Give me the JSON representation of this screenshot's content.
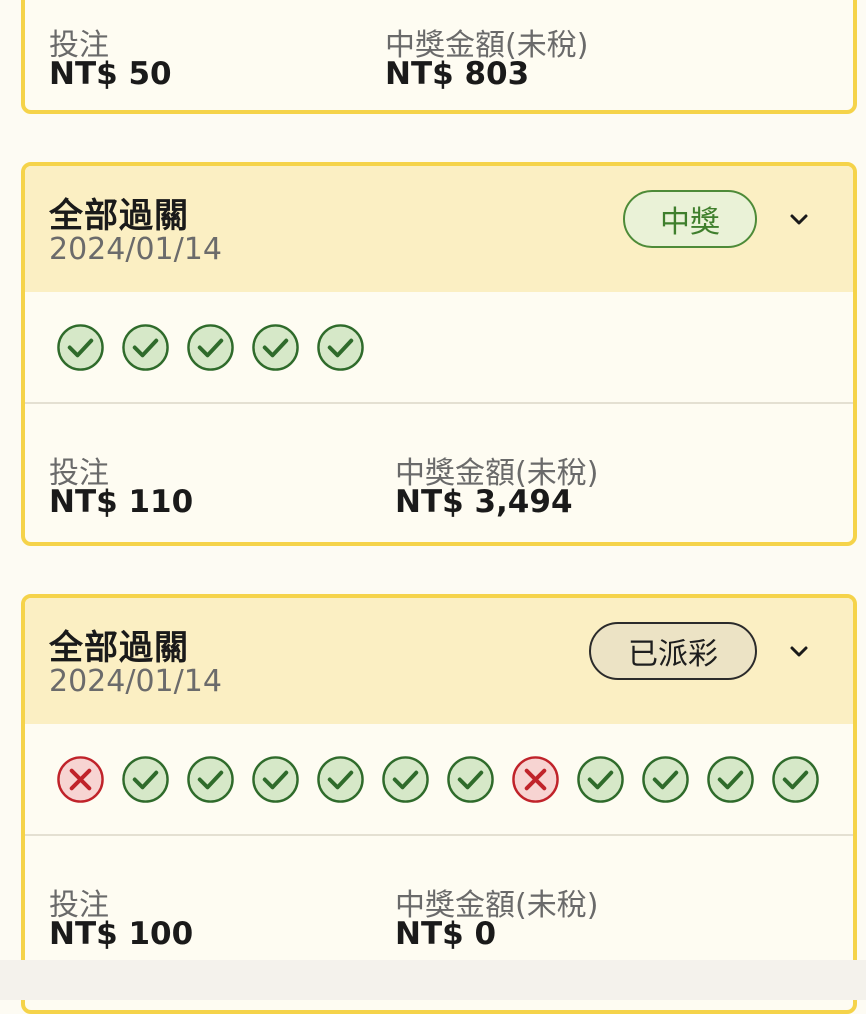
{
  "cards": [
    {
      "stake_label": "投注",
      "stake_value": "NT$ 50",
      "payout_label": "中獎金額(未稅)",
      "payout_value": "NT$ 803"
    },
    {
      "title": "全部過關",
      "date": "2024/01/14",
      "badge": "中獎",
      "results": [
        "win",
        "win",
        "win",
        "win",
        "win"
      ],
      "stake_label": "投注",
      "stake_value": "NT$ 110",
      "payout_label": "中獎金額(未稅)",
      "payout_value": "NT$ 3,494"
    },
    {
      "title": "全部過關",
      "date": "2024/01/14",
      "badge": "已派彩",
      "results": [
        "loss",
        "win",
        "win",
        "win",
        "win",
        "win",
        "win",
        "loss",
        "win",
        "win",
        "win",
        "win"
      ],
      "stake_label": "投注",
      "stake_value": "NT$ 100",
      "payout_label": "中獎金額(未稅)",
      "payout_value": "NT$ 0"
    }
  ],
  "icons": {
    "win": "check-circle-icon",
    "loss": "x-circle-icon",
    "toggle": "chevron-down-icon"
  },
  "colors": {
    "win_fill": "#d6e8c8",
    "win_stroke": "#2f6b2b",
    "loss_fill": "#f7d4d2",
    "loss_stroke": "#c0232a",
    "accent_border": "#f5d34a"
  }
}
